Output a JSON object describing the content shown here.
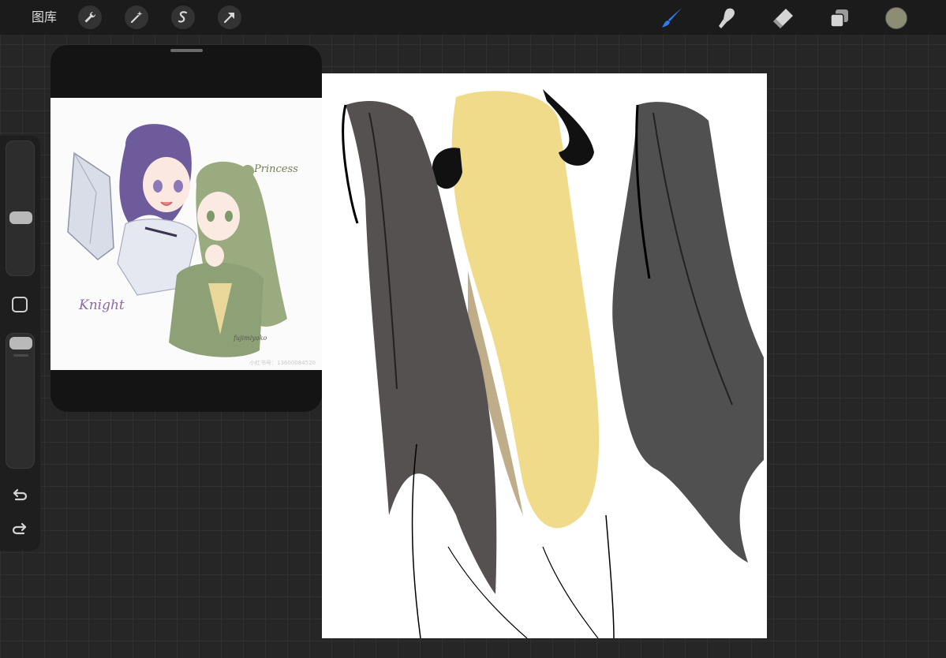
{
  "topbar": {
    "gallery_label": "图库",
    "left_tools": [
      "wrench-icon",
      "magic-wand-icon",
      "selection-icon",
      "transform-icon"
    ],
    "right_tools": [
      "brush-icon",
      "smudge-icon",
      "eraser-icon",
      "layers-icon"
    ],
    "active_tool": "brush",
    "active_tool_color": "#2f7df6",
    "current_color": "#8d8c74"
  },
  "sidebar": {
    "brush_size_level": 0.3,
    "opacity_level": 0.05,
    "modify_button_icon": "square-icon",
    "undo_icon": "undo-icon",
    "redo_icon": "redo-icon"
  },
  "reference": {
    "text_princess": "Princess",
    "text_knight": "Knight",
    "text_signature": "fujimiyako",
    "text_watermark": "小红书号：13600084520"
  },
  "canvas": {
    "hair_color": "#ecd782",
    "wing_color": "#4a4847",
    "line_color": "#000000"
  }
}
